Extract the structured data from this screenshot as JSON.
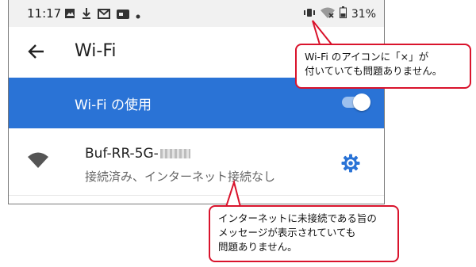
{
  "status_bar": {
    "time": "11:17",
    "battery": "31%"
  },
  "app_bar": {
    "title": "Wi-Fi"
  },
  "wifi_toggle": {
    "label": "Wi-Fi の使用",
    "enabled": true
  },
  "network": {
    "name": "Buf-RR-5G-",
    "status": "接続済み、インターネット接続なし"
  },
  "callout_top": {
    "lines": [
      "Wi-Fi のアイコンに「×」が",
      "付いていても問題ありません。"
    ]
  },
  "callout_bottom": {
    "lines": [
      "インターネットに未接続である旨の",
      "メッセージが表示されていても",
      "問題ありません。"
    ]
  },
  "colors": {
    "accent_blue": "#2a73d6",
    "callout_border": "#d9132c"
  }
}
